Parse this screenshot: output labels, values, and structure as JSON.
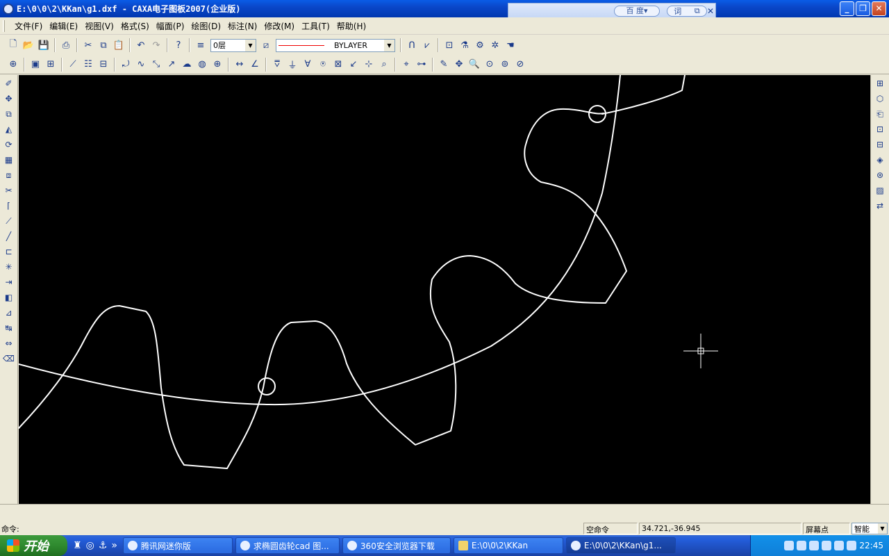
{
  "window": {
    "title": "E:\\0\\0\\2\\KKan\\g1.dxf - CAXA电子图板2007(企业版)"
  },
  "baidu_toolbar": {
    "search_label": "百 度▾",
    "dict_label": "词",
    "copy_label": "⧉",
    "close_label": "✕"
  },
  "menu": {
    "items": [
      {
        "label": "文件(F)"
      },
      {
        "label": "编辑(E)"
      },
      {
        "label": "视图(V)"
      },
      {
        "label": "格式(S)"
      },
      {
        "label": "幅面(P)"
      },
      {
        "label": "绘图(D)"
      },
      {
        "label": "标注(N)"
      },
      {
        "label": "修改(M)"
      },
      {
        "label": "工具(T)"
      },
      {
        "label": "帮助(H)"
      }
    ]
  },
  "toolbar": {
    "layer_value": "0层",
    "linetype_value": "BYLAYER"
  },
  "status": {
    "command_prompt": "命令:",
    "command_state": "空命令",
    "coordinates": "34.721,-36.945",
    "snap_label": "屏幕点",
    "snap_mode": "智能"
  },
  "taskbar": {
    "start_label": "开始",
    "tasks": [
      {
        "label": "腾讯网迷你版"
      },
      {
        "label": "求椭圆齿轮cad 图..."
      },
      {
        "label": "360安全浏览器下载"
      },
      {
        "label": "E:\\0\\0\\2\\KKan"
      },
      {
        "label": "E:\\0\\0\\2\\KKan\\g1..."
      }
    ],
    "clock": "22:45"
  },
  "colors": {
    "canvas_background": "#000000",
    "drawing_stroke": "#ffffff",
    "linetype_sample": "#e00000"
  }
}
